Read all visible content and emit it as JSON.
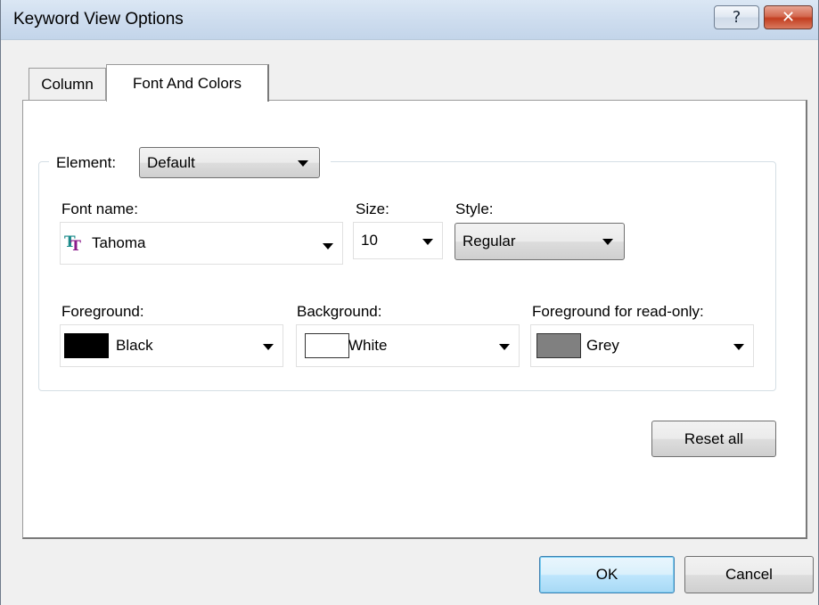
{
  "window": {
    "title": "Keyword View Options",
    "help_label": "?",
    "close_label": "✕"
  },
  "tabs": [
    {
      "label": "Column",
      "active": false
    },
    {
      "label": "Font And Colors",
      "active": true
    }
  ],
  "element": {
    "label": "Element:",
    "value": "Default"
  },
  "font": {
    "name_label": "Font name:",
    "name_value": "Tahoma",
    "icon": "truetype-font-icon",
    "size_label": "Size:",
    "size_value": "10",
    "style_label": "Style:",
    "style_value": "Regular"
  },
  "colors": {
    "foreground_label": "Foreground:",
    "foreground_value": "Black",
    "foreground_hex": "#000000",
    "background_label": "Background:",
    "background_value": "White",
    "background_hex": "#ffffff",
    "readonly_label": "Foreground for read-only:",
    "readonly_value": "Grey",
    "readonly_hex": "#808080"
  },
  "buttons": {
    "reset_all": "Reset all",
    "ok": "OK",
    "cancel": "Cancel"
  }
}
